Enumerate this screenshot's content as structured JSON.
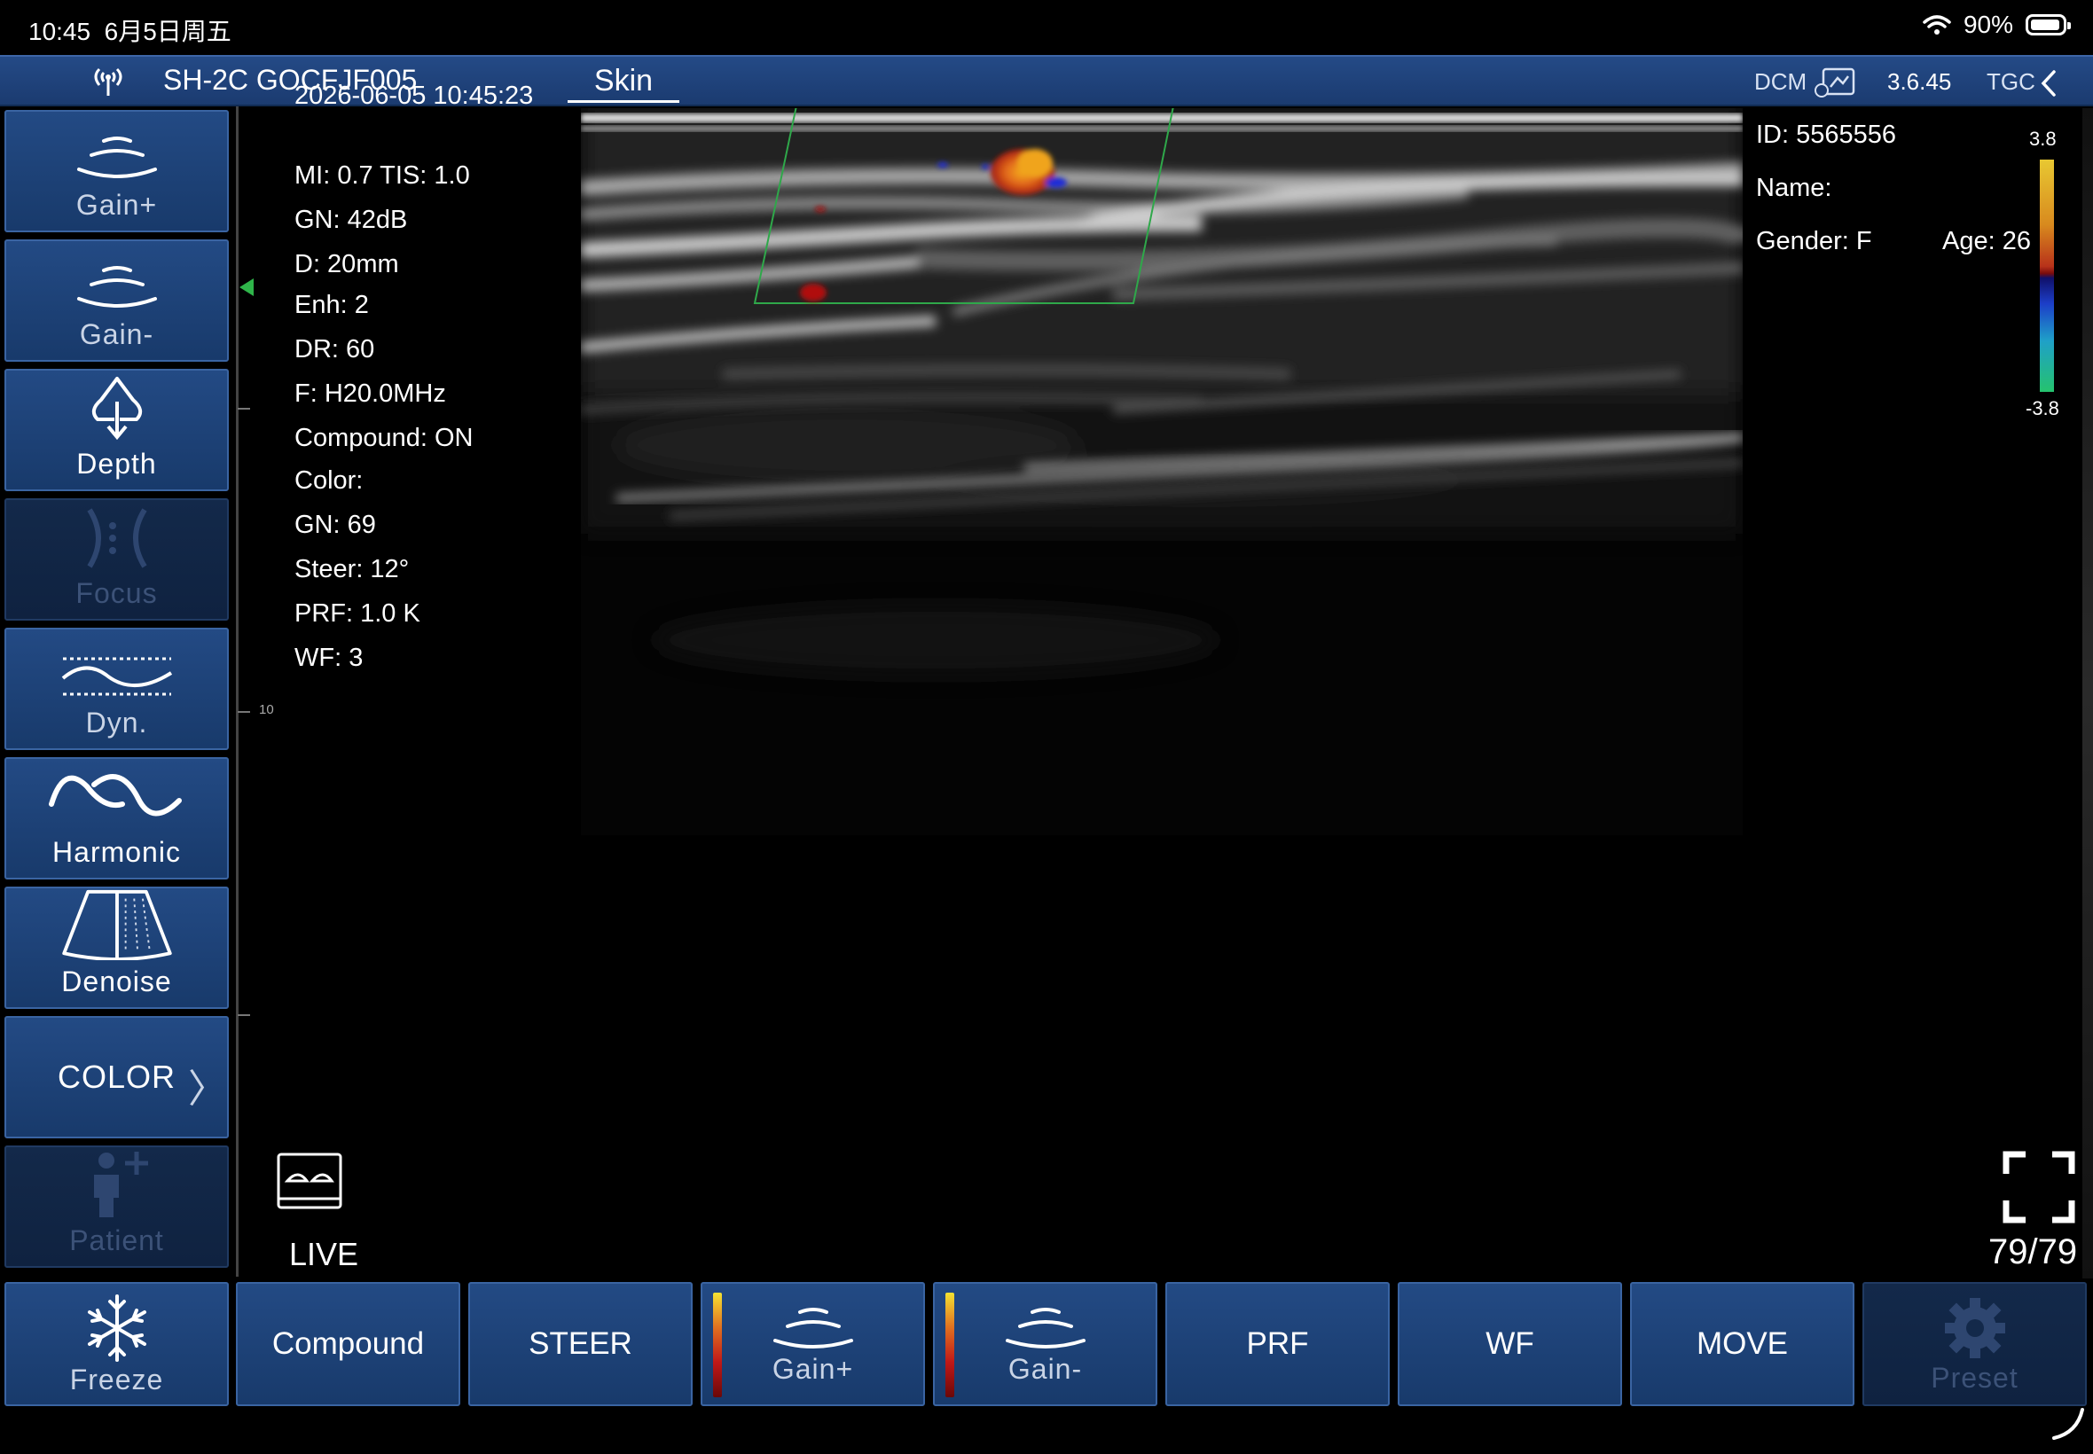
{
  "status_bar": {
    "time": "10:45",
    "date": "6月5日周五",
    "battery": "90%"
  },
  "header": {
    "device": "SH-2C GOCFJF005",
    "preset_tab": "Skin",
    "dcm": "DCM",
    "version": "3.6.45",
    "tgc": "TGC"
  },
  "sidebar": {
    "gain_plus": "Gain+",
    "gain_minus": "Gain-",
    "depth": "Depth",
    "focus": "Focus",
    "dyn": "Dyn.",
    "harmonic": "Harmonic",
    "denoise": "Denoise",
    "color": "COLOR",
    "patient": "Patient"
  },
  "ruler": {
    "tick_10": "10"
  },
  "params": {
    "datetime": "2026-06-05 10:45:23",
    "mi_tis": "MI: 0.7   TIS: 1.0",
    "gn": "GN: 42dB",
    "depth": "D: 20mm",
    "enh": "Enh: 2",
    "dr": "DR: 60",
    "freq": "F: H20.0MHz",
    "compound": "Compound: ON",
    "color": "Color:",
    "color_gn": "GN: 69",
    "steer": "Steer: 12°",
    "prf": "PRF: 1.0 K",
    "wf": "WF: 3"
  },
  "patient": {
    "id": "ID: 5565556",
    "name": "Name:",
    "gender": "Gender: F",
    "age": "Age: 26"
  },
  "color_scale": {
    "max": "3.8",
    "min": "-3.8"
  },
  "live": "LIVE",
  "frame_counter": "79/79",
  "bottom": {
    "freeze": "Freeze",
    "compound": "Compound",
    "steer": "STEER",
    "gain_plus": "Gain+",
    "gain_minus": "Gain-",
    "prf": "PRF",
    "wf": "WF",
    "move": "MOVE",
    "preset": "Preset"
  }
}
